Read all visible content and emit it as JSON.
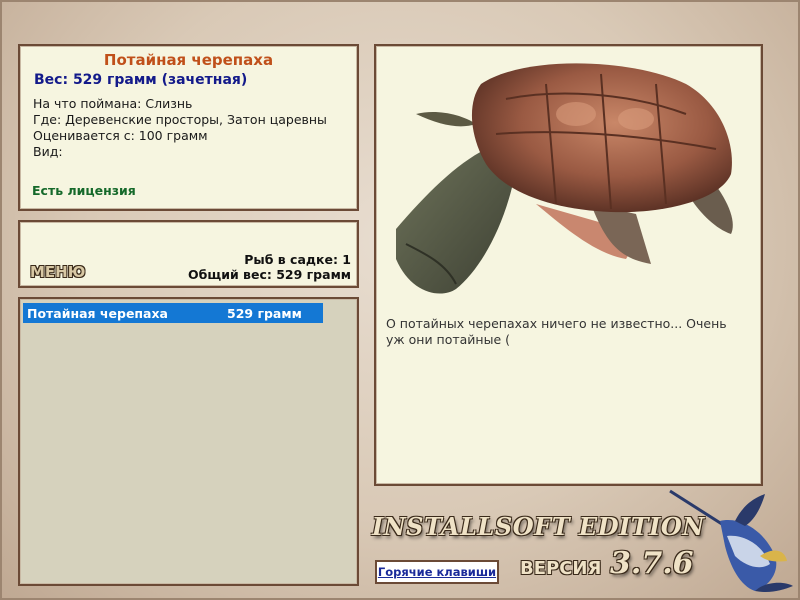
{
  "fish": {
    "name": "Потайная черепаха",
    "weight": "Вес: 529 грамм (зачетная)",
    "caught_on": "На что поймана: Слизнь",
    "location": "Где: Деревенские просторы, Затон царевны",
    "valued_from": "Оценивается с: 100 грамм",
    "kind": "Вид:",
    "license": "Есть лицензия"
  },
  "menu": {
    "label": "МЕНЮ"
  },
  "stats": {
    "fish_count": "Рыб в садке: 1",
    "total_weight": "Общий вес: 529 грамм"
  },
  "list": {
    "items": [
      {
        "name": "Потайная черепаха",
        "weight": "529 грамм"
      }
    ]
  },
  "description": "О потайных черепахах ничего не известно... Очень уж они потайные (",
  "branding": {
    "edition": "INSTALLSOFT EDITION",
    "version_label": "ВЕРСИЯ",
    "version": "3.7.6",
    "hotkeys": "Горячие клавиши"
  },
  "colors": {
    "title": "#c0501a",
    "weight": "#131a8a",
    "license": "#15692a",
    "selection": "#1478d4",
    "panel": "#f6f5e0"
  },
  "icons": [
    "turtle-image",
    "marlin-logo"
  ]
}
